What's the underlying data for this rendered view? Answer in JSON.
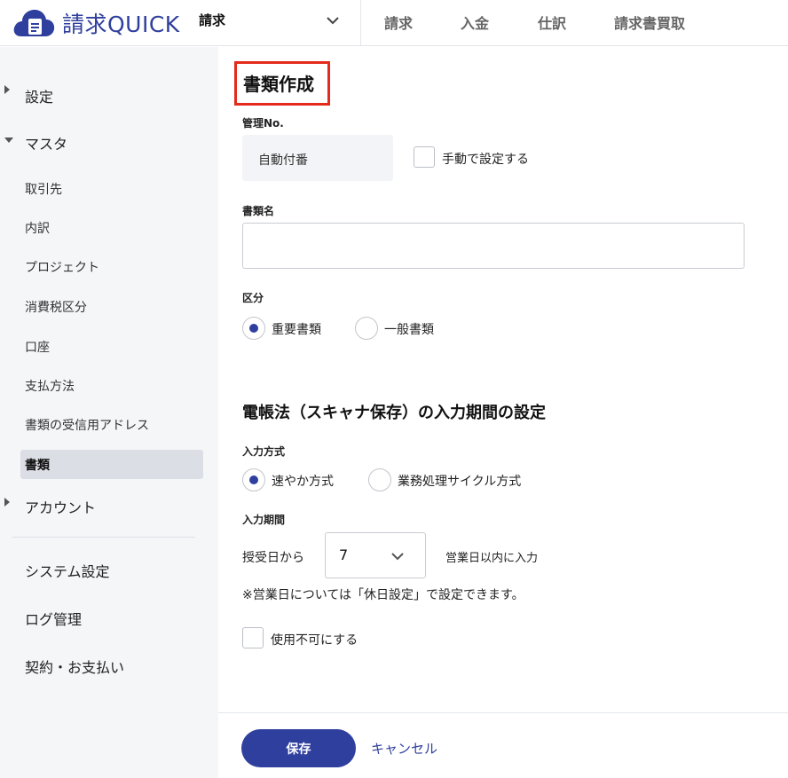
{
  "header": {
    "logo_text": "請求QUICK",
    "app_selector": "請求",
    "nav": [
      "請求",
      "入金",
      "仕訳",
      "請求書買取"
    ]
  },
  "sidebar": {
    "groups": {
      "settings": "設定",
      "master": "マスタ",
      "account": "アカウント"
    },
    "master_items": [
      "取引先",
      "内訳",
      "プロジェクト",
      "消費税区分",
      "口座",
      "支払方法",
      "書類の受信用アドレス",
      "書類"
    ],
    "active_item": "書類",
    "bottom_items": [
      "システム設定",
      "ログ管理",
      "契約・お支払い"
    ]
  },
  "form": {
    "title": "書類作成",
    "mgmt_no_label": "管理No.",
    "mgmt_no_value": "自動付番",
    "manual_checkbox_label": "手動で設定する",
    "doc_name_label": "書類名",
    "doc_name_value": "",
    "category_label": "区分",
    "category_options": [
      "重要書類",
      "一般書類"
    ],
    "category_selected": "重要書類",
    "section_title": "電帳法（スキャナ保存）の入力期間の設定",
    "input_method_label": "入力方式",
    "input_method_options": [
      "速やか方式",
      "業務処理サイクル方式"
    ],
    "input_method_selected": "速やか方式",
    "input_period_label": "入力期間",
    "period_prefix": "授受日から",
    "period_value": "7",
    "period_suffix": "営業日以内に入力",
    "note": "※営業日については「休日設定」で設定できます。",
    "disable_checkbox_label": "使用不可にする",
    "save_label": "保存",
    "cancel_label": "キャンセル"
  },
  "colors": {
    "brand": "#2f3f9e",
    "highlight_box": "#e42b1b",
    "sidebar_bg": "#f5f6f8",
    "active_item_bg": "#dcdee5"
  }
}
